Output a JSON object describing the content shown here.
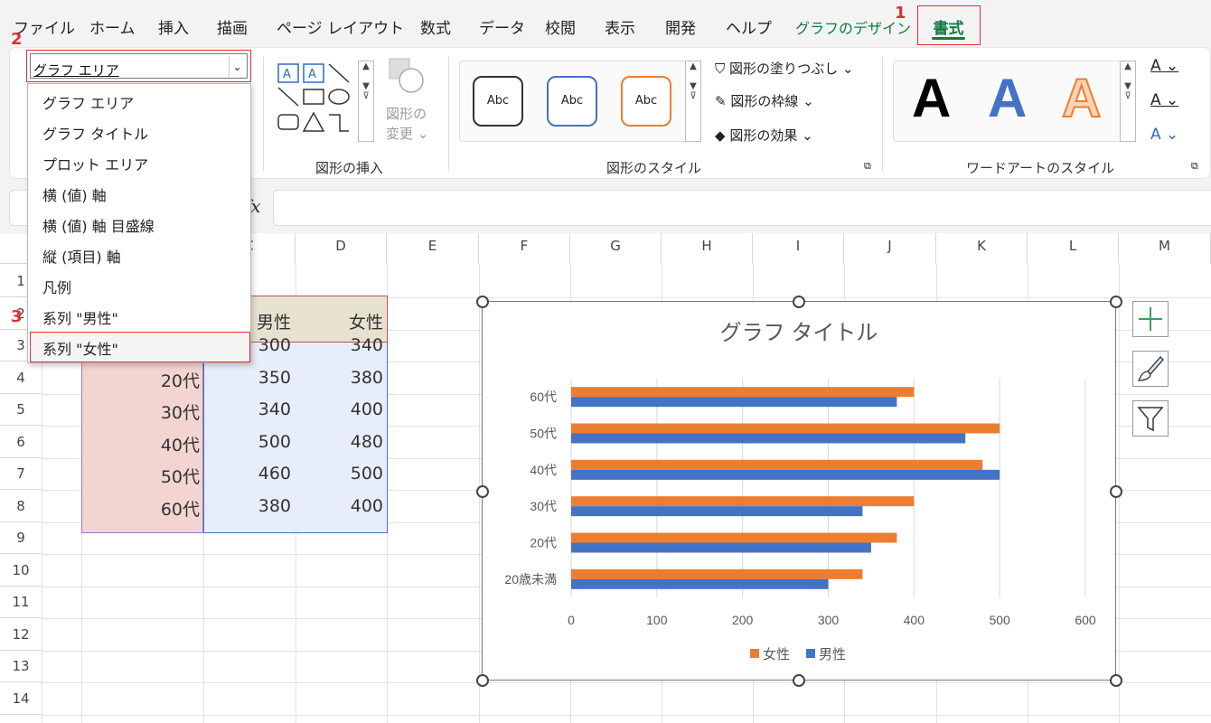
{
  "menu": {
    "items": [
      "ファイル",
      "ホーム",
      "挿入",
      "描画",
      "ページ レイアウト",
      "数式",
      "データ",
      "校閲",
      "表示",
      "開発",
      "ヘルプ",
      "グラフのデザイン"
    ],
    "active_tab": "書式"
  },
  "steps": {
    "one": "1",
    "two": "2",
    "three": "3"
  },
  "ribbon": {
    "selection_value": "グラフ エリア",
    "dropdown_options": [
      "グラフ エリア",
      "グラフ タイトル",
      "プロット エリア",
      "横 (値) 軸",
      "横 (値) 軸 目盛線",
      "縦 (項目) 軸",
      "凡例",
      "系列 \"男性\"",
      "系列 \"女性\""
    ],
    "change_shape_line1": "図形の",
    "change_shape_line2": "変更 ⌄",
    "insert_shapes_label": "図形の挿入",
    "style_preview_text": "Abc",
    "shape_fill": "図形の塗りつぶし ⌄",
    "shape_outline": "図形の枠線 ⌄",
    "shape_effects": "図形の効果 ⌄",
    "shape_styles_label": "図形のスタイル",
    "wordart_letter": "A",
    "wordart_label": "ワードアートのスタイル"
  },
  "formula_bar": {
    "fx": "fx"
  },
  "sheet": {
    "columns": [
      "C",
      "D",
      "E",
      "F",
      "G",
      "H",
      "I",
      "J",
      "K",
      "L",
      "M"
    ],
    "rows": [
      "1",
      "2",
      "3",
      "4",
      "5",
      "6",
      "7",
      "8",
      "9",
      "10",
      "11",
      "12",
      "13",
      "14"
    ],
    "header_male": "男性",
    "header_female": "女性",
    "ages": [
      "20代",
      "30代",
      "40代",
      "50代",
      "60代"
    ],
    "male": [
      "300",
      "350",
      "340",
      "500",
      "460",
      "380"
    ],
    "female": [
      "340",
      "380",
      "400",
      "480",
      "500",
      "400"
    ]
  },
  "colors": {
    "female": "#ed7d31",
    "male": "#4472c4",
    "accent_red": "#e03030",
    "excel_green": "#107c41"
  },
  "chart_data": {
    "type": "bar",
    "orientation": "horizontal",
    "title": "グラフ タイトル",
    "categories": [
      "20歳未満",
      "20代",
      "30代",
      "40代",
      "50代",
      "60代"
    ],
    "series": [
      {
        "name": "女性",
        "values": [
          340,
          380,
          400,
          480,
          500,
          400
        ]
      },
      {
        "name": "男性",
        "values": [
          300,
          350,
          340,
          500,
          460,
          380
        ]
      }
    ],
    "xlim": [
      0,
      600
    ],
    "xticks": [
      "0",
      "100",
      "200",
      "300",
      "400",
      "500",
      "600"
    ],
    "grid": true,
    "legend_position": "bottom"
  }
}
